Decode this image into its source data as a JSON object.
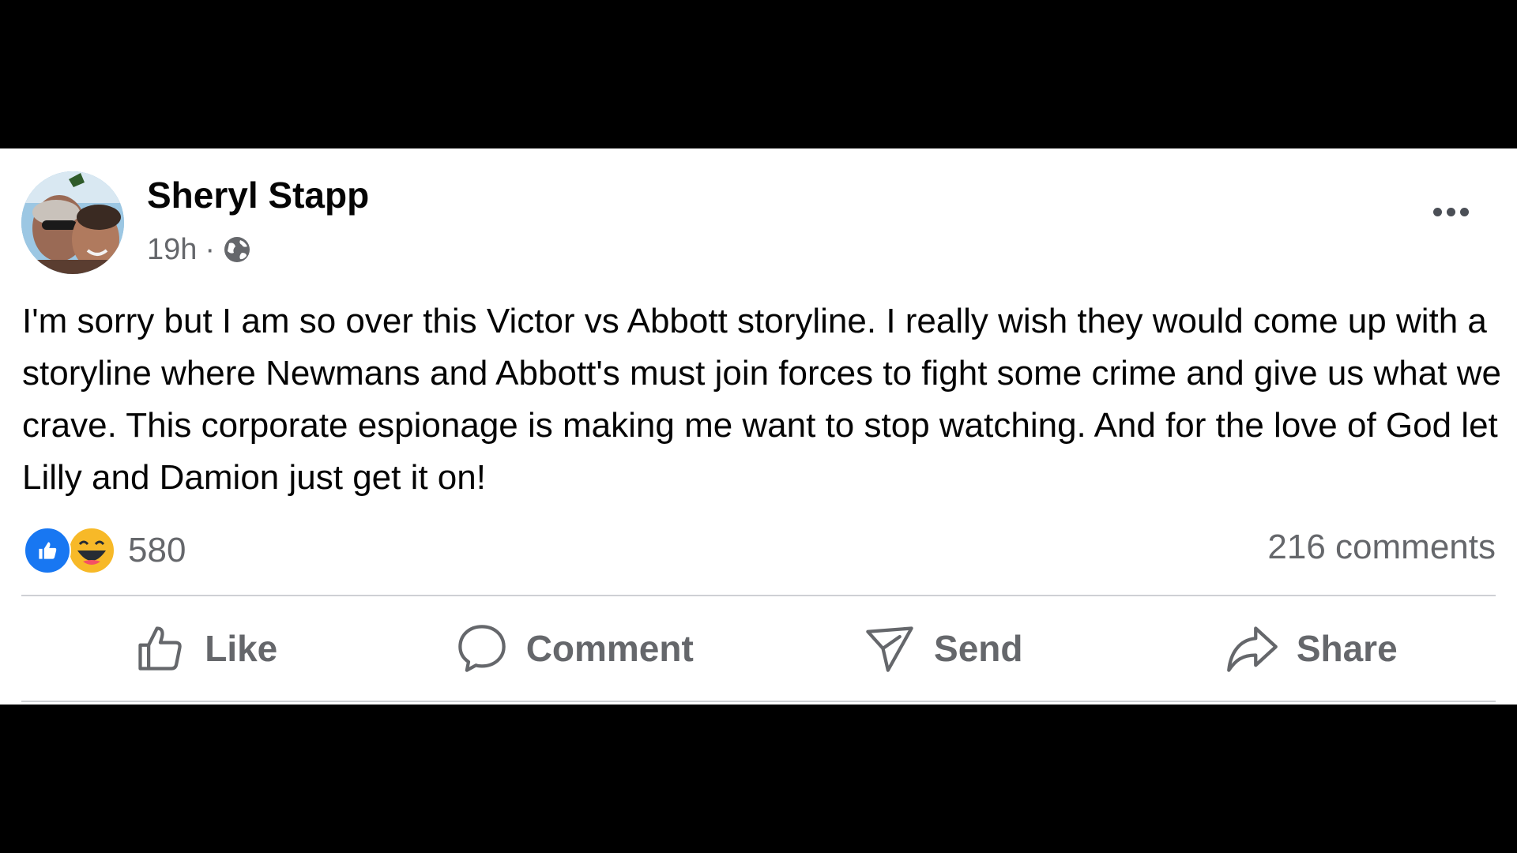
{
  "post": {
    "author": "Sheryl Stapp",
    "timestamp": "19h",
    "separator": "·",
    "privacy_icon": "globe-icon",
    "text": "I'm sorry but I am so over this Victor vs Abbott storyline. I really wish they would come up with a storyline where Newmans and Abbott's must join forces to fight some crime and give us what we crave. This corporate espionage is making me want to stop watching. And for the love of God let Lilly and Damion just get it on!",
    "more_icon": "more-horizontal-icon"
  },
  "engagement": {
    "reaction_icons": [
      "like-reaction-icon",
      "haha-reaction-icon"
    ],
    "reaction_count": "580",
    "comments": "216 comments"
  },
  "actions": {
    "like_label": "Like",
    "comment_label": "Comment",
    "send_label": "Send",
    "share_label": "Share"
  },
  "colors": {
    "text_primary": "#050505",
    "text_secondary": "#65676b",
    "like_blue": "#1877f2",
    "haha_yellow": "#f7b928",
    "divider": "#ced0d4",
    "background_letterbox": "#000000"
  }
}
